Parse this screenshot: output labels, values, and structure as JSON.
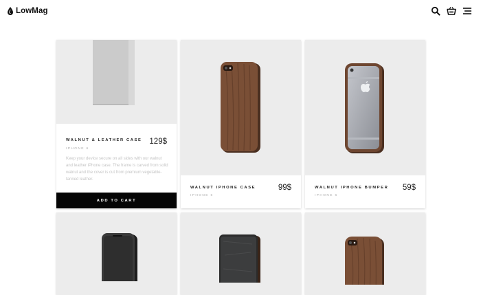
{
  "header": {
    "brand": "LowMag",
    "icons": [
      "logo-drop-icon",
      "search-icon",
      "cart-icon",
      "menu-icon"
    ]
  },
  "products": [
    {
      "name": "Walnut & Leather Case",
      "price": "129$",
      "subtitle": "iPhone 6",
      "description": "Keep your device secure on all sides with our walnut and leather iPhone case. The frame is carved from solid walnut and the cover is cut from premium vegetable-tanned leather.",
      "button": "Add to cart"
    },
    {
      "name": "Walnut iPhone Case",
      "price": "99$",
      "subtitle": "iPhone 6"
    },
    {
      "name": "Walnut iPhone Bumper",
      "price": "59$",
      "subtitle": "iPhone 6"
    }
  ],
  "colors": {
    "card_image_bg": "#ececec",
    "walnut": "#6b4630",
    "button_bg": "#050505",
    "muted_text": "#c4c4c4"
  }
}
